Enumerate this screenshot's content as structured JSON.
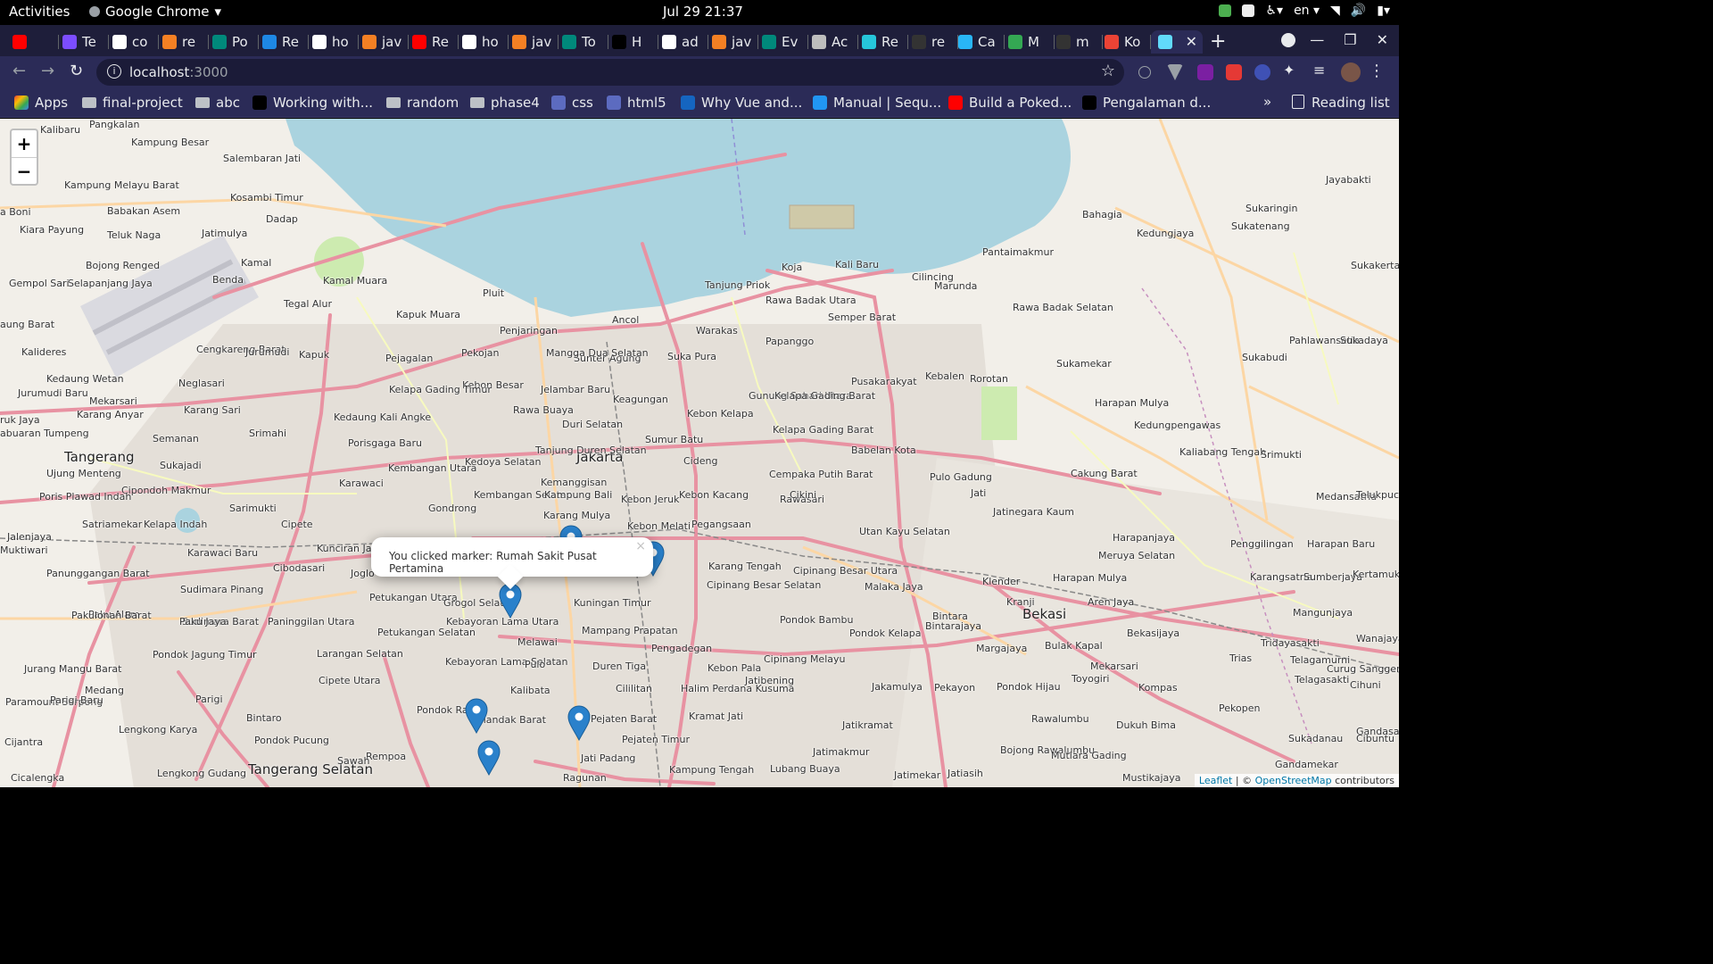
{
  "system_bar": {
    "activities": "Activities",
    "app_name": "Google Chrome",
    "clock": "Jul 29  21:37",
    "lang": "en"
  },
  "tabs": [
    {
      "label": "",
      "favicon_color": "#ff0000",
      "icon": "youtube-icon"
    },
    {
      "label": "Te",
      "favicon_color": "#7c4dff",
      "icon": "list-icon"
    },
    {
      "label": "co",
      "favicon_color": "#ffffff",
      "icon": "google-icon"
    },
    {
      "label": "re",
      "favicon_color": "#f48024",
      "icon": "stackoverflow-icon"
    },
    {
      "label": "Po",
      "favicon_color": "#00897b",
      "icon": "leaf-icon"
    },
    {
      "label": "Re",
      "favicon_color": "#1e88e5",
      "icon": "react-icon"
    },
    {
      "label": "ho",
      "favicon_color": "#ffffff",
      "icon": "google-icon"
    },
    {
      "label": "jav",
      "favicon_color": "#f48024",
      "icon": "stackoverflow-icon"
    },
    {
      "label": "Re",
      "favicon_color": "#ff0000",
      "icon": "youtube-icon"
    },
    {
      "label": "ho",
      "favicon_color": "#ffffff",
      "icon": "google-icon"
    },
    {
      "label": "jav",
      "favicon_color": "#f48024",
      "icon": "stackoverflow-icon"
    },
    {
      "label": "To",
      "favicon_color": "#00897b",
      "icon": "leaf-icon"
    },
    {
      "label": "H",
      "favicon_color": "#000000",
      "icon": "dev-icon"
    },
    {
      "label": "ad",
      "favicon_color": "#ffffff",
      "icon": "google-icon"
    },
    {
      "label": "jav",
      "favicon_color": "#f48024",
      "icon": "stackoverflow-icon"
    },
    {
      "label": "Ev",
      "favicon_color": "#00897b",
      "icon": "leaf-icon"
    },
    {
      "label": "Ac",
      "favicon_color": "#bdbdbd",
      "icon": "cube-icon"
    },
    {
      "label": "Re",
      "favicon_color": "#26c6da",
      "icon": "react-icon"
    },
    {
      "label": "re",
      "favicon_color": "#333333",
      "icon": "github-icon"
    },
    {
      "label": "Ca",
      "favicon_color": "#29b6f6",
      "icon": "trello-icon"
    },
    {
      "label": "M",
      "favicon_color": "#34a853",
      "icon": "maps-icon"
    },
    {
      "label": "m",
      "favicon_color": "#333333",
      "icon": "github-icon"
    },
    {
      "label": "Ko",
      "favicon_color": "#ea4335",
      "icon": "gmail-icon"
    },
    {
      "label": "",
      "favicon_color": "#61dafb",
      "icon": "react-icon",
      "active": true
    }
  ],
  "address_bar": {
    "host": "localhost",
    "port": ":3000"
  },
  "bookmarks": [
    {
      "label": "Apps",
      "type": "apps"
    },
    {
      "label": "final-project",
      "type": "folder"
    },
    {
      "label": "abc",
      "type": "folder"
    },
    {
      "label": "Working with...",
      "type": "site",
      "color": "#000000"
    },
    {
      "label": "random",
      "type": "folder"
    },
    {
      "label": "phase4",
      "type": "folder"
    },
    {
      "label": "css",
      "type": "site",
      "color": "#5c6bc0"
    },
    {
      "label": "html5",
      "type": "site",
      "color": "#5c6bc0"
    },
    {
      "label": "Why Vue and...",
      "type": "site",
      "color": "#1565c0"
    },
    {
      "label": "Manual | Sequ...",
      "type": "site",
      "color": "#2196f3"
    },
    {
      "label": "Build a Poked...",
      "type": "site",
      "color": "#ff0000"
    },
    {
      "label": "Pengalaman d...",
      "type": "site",
      "color": "#000000"
    }
  ],
  "bookmarks_more": "»",
  "reading_list": "Reading list",
  "map": {
    "zoom_in": "+",
    "zoom_out": "−",
    "popup_text": "You clicked marker: Rumah Sakit Pusat Pertamina",
    "popup_close": "×",
    "attribution_leaflet": "Leaflet",
    "attribution_sep": " | © ",
    "attribution_osm": "OpenStreetMap",
    "attribution_tail": " contributors",
    "labels": [
      {
        "text": "Jakarta",
        "cls": "city"
      },
      {
        "text": "Tangerang",
        "cls": "city"
      },
      {
        "text": "Bekasi",
        "cls": "city"
      },
      {
        "text": "Tangerang Selatan",
        "cls": "city"
      },
      {
        "text": "Kalibaru"
      },
      {
        "text": "Pangkalan"
      },
      {
        "text": "Kampung Besar"
      },
      {
        "text": "Salembaran Jati"
      },
      {
        "text": "Kosambi Timur"
      },
      {
        "text": "Dadap"
      },
      {
        "text": "Jatimulya"
      },
      {
        "text": "Kampung Melayu Barat"
      },
      {
        "text": "Babakan Asem"
      },
      {
        "text": "Teluk Naga"
      },
      {
        "text": "Kiara Payung"
      },
      {
        "text": "Bojong Renged"
      },
      {
        "text": "Kamal"
      },
      {
        "text": "Kamal Muara"
      },
      {
        "text": "Pluit"
      },
      {
        "text": "Tegal Alur"
      },
      {
        "text": "Kapuk Muara"
      },
      {
        "text": "Penjaringan"
      },
      {
        "text": "Ancol"
      },
      {
        "text": "Tanjung Priok"
      },
      {
        "text": "Koja"
      },
      {
        "text": "Kali Baru"
      },
      {
        "text": "Cilincing"
      },
      {
        "text": "Marunda"
      },
      {
        "text": "Bahagia"
      },
      {
        "text": "Kedungjaya"
      },
      {
        "text": "Sukaringin"
      },
      {
        "text": "Sukatenang"
      },
      {
        "text": "Jayabakti"
      },
      {
        "text": "Pantaimakmur"
      },
      {
        "text": "Sukakerta"
      },
      {
        "text": "Rawa Badak Utara"
      },
      {
        "text": "Semper Barat"
      },
      {
        "text": "Warakas"
      },
      {
        "text": "Papanggo"
      },
      {
        "text": "Rawa Badak Selatan"
      },
      {
        "text": "Pahlawansetia"
      },
      {
        "text": "Sukadaya"
      },
      {
        "text": "Sukabudi"
      },
      {
        "text": "Sukamekar"
      },
      {
        "text": "Kebalen"
      },
      {
        "text": "Rorotan"
      },
      {
        "text": "Pusakarakyat"
      },
      {
        "text": "Suka Pura"
      },
      {
        "text": "Sunter Agung"
      },
      {
        "text": "Mangga Dua Selatan"
      },
      {
        "text": "Pekojan"
      },
      {
        "text": "Pejagalan"
      },
      {
        "text": "Kapuk"
      },
      {
        "text": "Cengkareng Barat"
      },
      {
        "text": "Jurumudi"
      },
      {
        "text": "Kalideres"
      },
      {
        "text": "Kedaung Wetan"
      },
      {
        "text": "Neglasari"
      },
      {
        "text": "Jurumudi Baru"
      },
      {
        "text": "Mekarsari"
      },
      {
        "text": "Karang Anyar"
      },
      {
        "text": "Karang Sari"
      },
      {
        "text": "Kebon Besar"
      },
      {
        "text": "Jelambar Baru"
      },
      {
        "text": "Keagungan"
      },
      {
        "text": "Gunung Sahari Utara"
      },
      {
        "text": "Kelapa Gading Barat"
      },
      {
        "text": "Kelapa Gading Timur"
      },
      {
        "text": "Kedaung Kali Angke"
      },
      {
        "text": "Rawa Buaya"
      },
      {
        "text": "Duri Selatan"
      },
      {
        "text": "Kebon Kelapa"
      },
      {
        "text": "Sumur Batu"
      },
      {
        "text": "Harapan Mulya"
      },
      {
        "text": "Kedungpengawas"
      },
      {
        "text": "Babelan Kota"
      },
      {
        "text": "Cakung Barat"
      },
      {
        "text": "Kaliabang Tengah"
      },
      {
        "text": "Srimukti"
      },
      {
        "text": "Srimahi"
      },
      {
        "text": "Semanan"
      },
      {
        "text": "Porisgaga Baru"
      },
      {
        "text": "Kembangan Utara"
      },
      {
        "text": "Kedoya Selatan"
      },
      {
        "text": "Tanjung Duren Selatan"
      },
      {
        "text": "Cideng"
      },
      {
        "text": "Cempaka Putih Barat"
      },
      {
        "text": "Pulo Gadung"
      },
      {
        "text": "Ujung Menteng"
      },
      {
        "text": "Sukajadi"
      },
      {
        "text": "Cipondoh Makmur"
      },
      {
        "text": "Poris Plawad Indah"
      },
      {
        "text": "Karawaci"
      },
      {
        "text": "Kembangan Selatan"
      },
      {
        "text": "Kemanggisan"
      },
      {
        "text": "Kampung Bali"
      },
      {
        "text": "Kebon Kacang"
      },
      {
        "text": "Rawasari"
      },
      {
        "text": "Jati"
      },
      {
        "text": "Medansatria"
      },
      {
        "text": "Sarimukti"
      },
      {
        "text": "Gondrong"
      },
      {
        "text": "Kebon Jeruk"
      },
      {
        "text": "Cikini"
      },
      {
        "text": "Jatinegara Kaum"
      },
      {
        "text": "Harapanjaya"
      },
      {
        "text": "Telukpucung"
      },
      {
        "text": "Satriamekar"
      },
      {
        "text": "Kelapa Indah"
      },
      {
        "text": "Cipete"
      },
      {
        "text": "Karang Mulya"
      },
      {
        "text": "Kebon Melati"
      },
      {
        "text": "Pegangsaan"
      },
      {
        "text": "Utan Kayu Selatan"
      },
      {
        "text": "Penggilingan"
      },
      {
        "text": "Jalenjaya"
      },
      {
        "text": "Karawaci Baru"
      },
      {
        "text": "Kunciran Jaya"
      },
      {
        "text": "Meruya Selatan"
      },
      {
        "text": "Harapan Baru"
      },
      {
        "text": "Muktiwari"
      },
      {
        "text": "Cibodasari"
      },
      {
        "text": "Karang Tengah"
      },
      {
        "text": "Cipinang Besar Utara"
      },
      {
        "text": "Klender"
      },
      {
        "text": "Harapan Mulya"
      },
      {
        "text": "Karangsatria"
      },
      {
        "text": "Sumberjaya"
      },
      {
        "text": "Kertamukti"
      },
      {
        "text": "Panunggangan Barat"
      },
      {
        "text": "Sudimara Pinang"
      },
      {
        "text": "Joglo"
      },
      {
        "text": "Petukangan Utara"
      },
      {
        "text": "Grogol Selatan"
      },
      {
        "text": "Kuningan Timur"
      },
      {
        "text": "Cipinang Besar Selatan"
      },
      {
        "text": "Malaka Jaya"
      },
      {
        "text": "Kranji"
      },
      {
        "text": "Aren Jaya"
      },
      {
        "text": "Mangunjaya"
      },
      {
        "text": "Paku Alam"
      },
      {
        "text": "Sudimara Barat"
      },
      {
        "text": "Pakulonan Barat"
      },
      {
        "text": "Paku Jaya"
      },
      {
        "text": "Paninggilan Utara"
      },
      {
        "text": "Petukangan Selatan"
      },
      {
        "text": "Kebayoran Lama Utara"
      },
      {
        "text": "Melawai"
      },
      {
        "text": "Mampang Prapatan"
      },
      {
        "text": "Pengadegan"
      },
      {
        "text": "Pondok Bambu"
      },
      {
        "text": "Pondok Kelapa"
      },
      {
        "text": "Bintara"
      },
      {
        "text": "Bintarajaya"
      },
      {
        "text": "Bekasijaya"
      },
      {
        "text": "Tridayasakti"
      },
      {
        "text": "Wanajaya"
      },
      {
        "text": "Pondok Jagung Timur"
      },
      {
        "text": "Larangan Selatan"
      },
      {
        "text": "Kebayoran Lama Selatan"
      },
      {
        "text": "Pulo"
      },
      {
        "text": "Duren Tiga"
      },
      {
        "text": "Kebon Pala"
      },
      {
        "text": "Cipinang Melayu"
      },
      {
        "text": "Margajaya"
      },
      {
        "text": "Bulak Kapal"
      },
      {
        "text": "Mekarsari"
      },
      {
        "text": "Trias"
      },
      {
        "text": "Telagamurni"
      },
      {
        "text": "Curug Sanggereng"
      },
      {
        "text": "Jurang Mangu Barat"
      },
      {
        "text": "Cipete Utara"
      },
      {
        "text": "Kalibata"
      },
      {
        "text": "Cililitan"
      },
      {
        "text": "Halim Perdana Kusuma"
      },
      {
        "text": "Jatibening"
      },
      {
        "text": "Jakamulya"
      },
      {
        "text": "Pekayon"
      },
      {
        "text": "Pondok Hijau"
      },
      {
        "text": "Toyogiri"
      },
      {
        "text": "Kompas"
      },
      {
        "text": "Telagasakti"
      },
      {
        "text": "Cihuni"
      },
      {
        "text": "Medang"
      },
      {
        "text": "Paramount Serpong"
      },
      {
        "text": "Parigi Baru"
      },
      {
        "text": "Parigi"
      },
      {
        "text": "Bintaro"
      },
      {
        "text": "Pondok Ranji"
      },
      {
        "text": "Cilandak Barat"
      },
      {
        "text": "Pejaten Barat"
      },
      {
        "text": "Pejaten Timur"
      },
      {
        "text": "Kramat Jati"
      },
      {
        "text": "Jatikramat"
      },
      {
        "text": "Rawalumbu"
      },
      {
        "text": "Dukuh Bima"
      },
      {
        "text": "Pekopen"
      },
      {
        "text": "Sukadanau"
      },
      {
        "text": "Gandasari"
      },
      {
        "text": "Cibuntu"
      },
      {
        "text": "Lengkong Karya"
      },
      {
        "text": "Pondok Pucung"
      },
      {
        "text": "Rempoa"
      },
      {
        "text": "Jati Padang"
      },
      {
        "text": "Kampung Tengah"
      },
      {
        "text": "Jatimakmur"
      },
      {
        "text": "Bojong Rawalumbu"
      },
      {
        "text": "Mutiara Gading"
      },
      {
        "text": "Cijantra"
      },
      {
        "text": "Lengkong Gudang"
      },
      {
        "text": "Sawah"
      },
      {
        "text": "Ragunan"
      },
      {
        "text": "Lubang Buaya"
      },
      {
        "text": "Jatimekar"
      },
      {
        "text": "Jatiasih"
      },
      {
        "text": "Mustikajaya"
      },
      {
        "text": "Gandamekar"
      },
      {
        "text": "Cicalengka"
      },
      {
        "text": "Selapanjang Jaya"
      },
      {
        "text": "Gempol Sari"
      },
      {
        "text": "Benda"
      },
      {
        "text": "aung Barat"
      },
      {
        "text": "ruk Jaya"
      },
      {
        "text": "abuaran Tumpeng"
      },
      {
        "text": "a Boni"
      },
      {
        "text": "Kelapa Gading Barat"
      }
    ]
  }
}
